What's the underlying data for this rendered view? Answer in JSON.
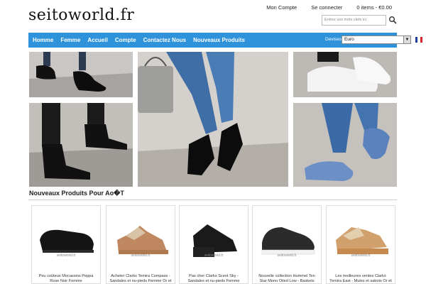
{
  "header": {
    "logo": "seitoworld.fr",
    "links": [
      "Mon Compte",
      "Se connecter",
      "0 items - €0.00"
    ],
    "search_placeholder": "Entrez vos mots clefs ici"
  },
  "nav": {
    "items": [
      "Homme",
      "Femme",
      "Accueil",
      "Compte",
      "Contactez Nous",
      "Nouveaux Produits"
    ],
    "devises_label": "Devises:",
    "currency": "Euro",
    "accent": "#2f93dc"
  },
  "hero": {
    "images": [
      "black-oxford-shoes-photo",
      "black-ankle-boots-photo",
      "black-lace-up-sandals-with-handbag-photo",
      "white-sneakers-photo",
      "blue-white-sneakers-photo"
    ]
  },
  "section": {
    "title": "Nouveaux Produits Pour Ao�T"
  },
  "products": [
    {
      "watermark": "seitoworld.fr",
      "title": "Peu coûteux Mocassins Peppa Rose Noir Femme"
    },
    {
      "watermark": "seitoworld.fr",
      "title": "Acheter Clarks Temira Compass - Sandales et nu-pieds Femme Or et"
    },
    {
      "watermark": "seitoworld.fr",
      "title": "Pas cher Clarks Scent Sky - Sandales et nu-pieds Femme"
    },
    {
      "watermark": "seitoworld.fr",
      "title": "Nouvelle collection Hummel Ten Star Mono Oiled Low - Baskets Homme"
    },
    {
      "watermark": "seitoworld.fr",
      "title": "Les meilleures ventes Clarks Temira East - Mules et sabots Or et bronze"
    }
  ]
}
